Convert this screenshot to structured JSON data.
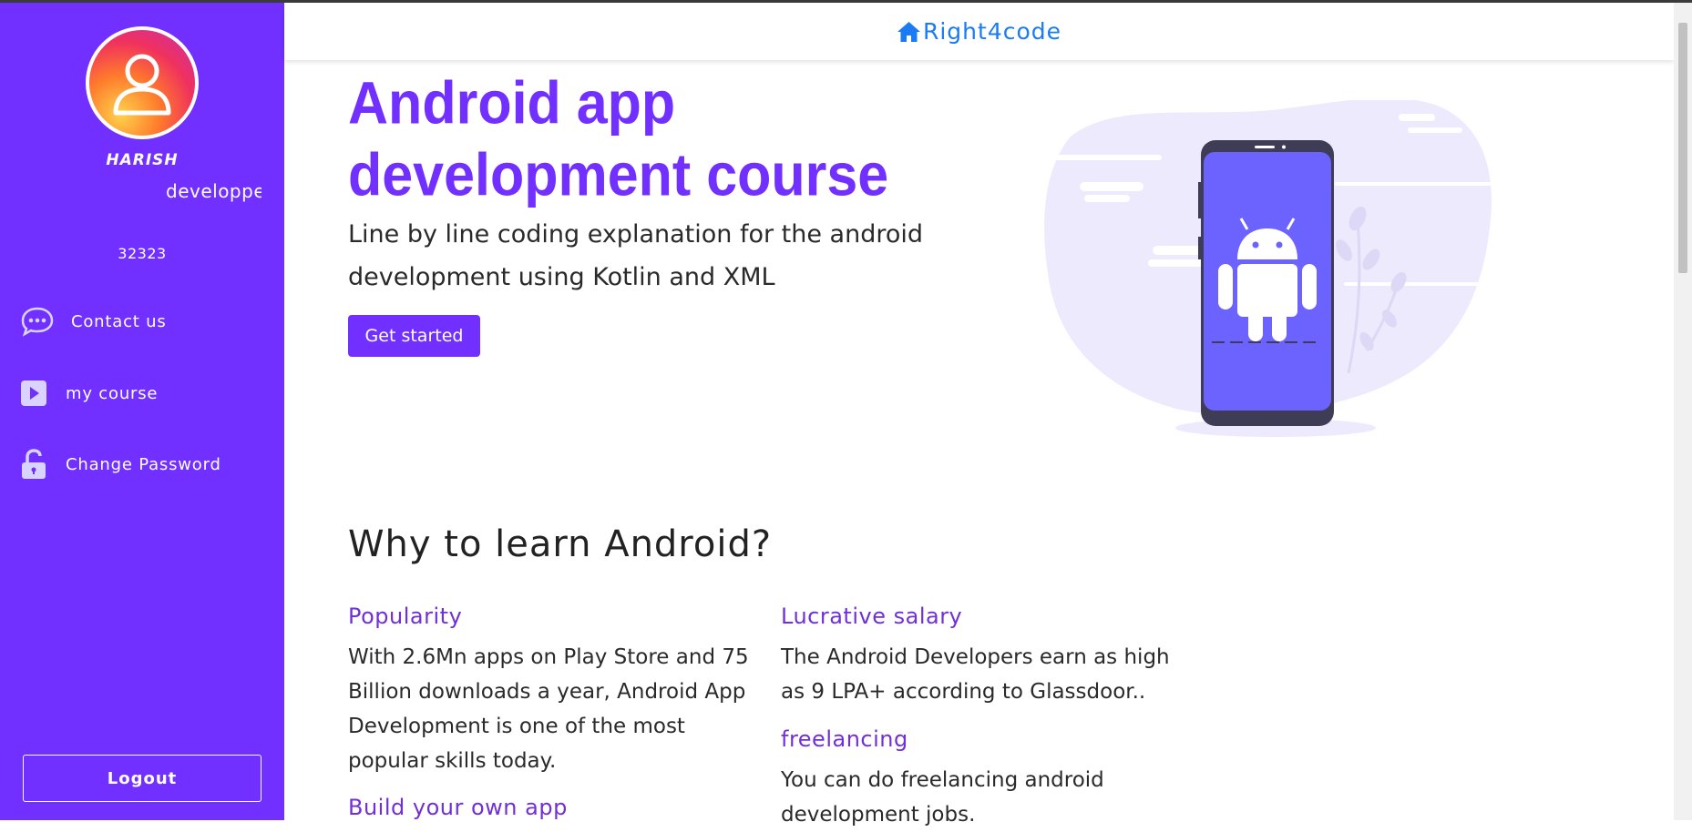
{
  "sidebar": {
    "user_name": "HARISH",
    "user_role": "developper",
    "user_id": "32323",
    "nav": [
      {
        "label": "Contact us",
        "icon": "chat-bubble-icon"
      },
      {
        "label": "my course",
        "icon": "play-icon"
      },
      {
        "label": "Change Password",
        "icon": "unlock-icon"
      }
    ],
    "logout_label": "Logout",
    "bg_color": "#7130ff"
  },
  "header": {
    "brand": "Right4code",
    "brand_icon": "home-icon",
    "brand_color": "#1b7bf5"
  },
  "hero": {
    "title": "Android app development course",
    "subtitle": "Line by line coding explanation for the android development using Kotlin and XML",
    "cta_label": "Get started"
  },
  "why": {
    "title": "Why to learn Android?",
    "items": [
      {
        "title": "Popularity",
        "body": "With 2.6Mn apps on Play Store and 75 Billion downloads a year, Android App Development is one of the most popular skills today."
      },
      {
        "title": "Lucrative salary",
        "body": "The Android Developers earn as high as 9 LPA+ according to Glassdoor.."
      },
      {
        "title": "freelancing",
        "body": "You can do freelancing android development jobs."
      },
      {
        "title": "Build your own app",
        "body": ""
      }
    ]
  }
}
